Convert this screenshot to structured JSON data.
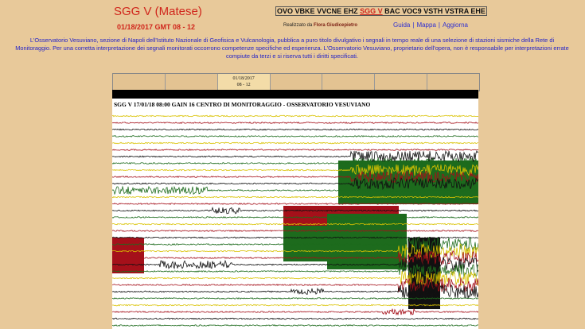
{
  "header": {
    "title": "SGG V (Matese)",
    "subtitle": "01/18/2017 GMT 08 - 12",
    "credit_prefix": "Realizzato da",
    "credit_name": "Flora Giudicepietro"
  },
  "stations": [
    {
      "label": "OVO"
    },
    {
      "label": "VBKE"
    },
    {
      "label": "VVCNE"
    },
    {
      "label": "EHZ"
    },
    {
      "label": "SGG V",
      "current": true
    },
    {
      "label": "BAC"
    },
    {
      "label": "VOC9"
    },
    {
      "label": "VSTH"
    },
    {
      "label": "VSTRA"
    },
    {
      "label": "EHE"
    }
  ],
  "links": {
    "guide": "Guida",
    "map": "Mappa",
    "update": "Aggiorna"
  },
  "disclaimer": "L'Osservatorio Vesuviano, sezione di Napoli dell'Istituto Nazionale di Geofisica e Vulcanologia, pubblica a puro titolo divulgativo i segnali in tempo reale di una selezione di stazioni sismiche della Rete di Monitoraggio. Per una corretta interpretazione dei segnali monitorati occorrono competenze specifiche ed esperienza. L'Osservatorio Vesuviano, proprietario dell'opera, non è responsabile per interpretazioni errate compiute da terzi e si riserva tutti i diritti specificati.",
  "timebar": {
    "active_date": "01/18/2017",
    "active_range": "08 - 12"
  },
  "seismogram": {
    "header": "SGG V 17/01/18 08:00 GAIN  16  CENTRO DI MONITORAGGIO - OSSERVATORIO VESUVIANO",
    "colors": {
      "black": "#111111",
      "red": "#a5101a",
      "green": "#1d6b1d",
      "yellow": "#d9c200",
      "background": "#ffffff",
      "page": "#e8c99a"
    }
  }
}
